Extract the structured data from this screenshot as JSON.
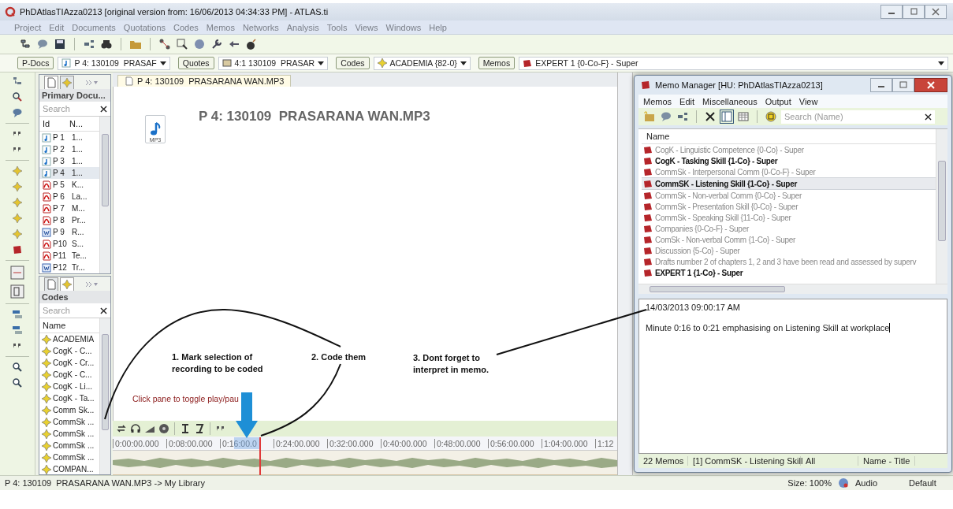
{
  "window": {
    "title": "PhDAtlasTIAzza0213 [original version from: 16/06/2013 04:34:33 PM] - ATLAS.ti"
  },
  "menu": [
    "Project",
    "Edit",
    "Documents",
    "Quotations",
    "Codes",
    "Memos",
    "Networks",
    "Analysis",
    "Tools",
    "Views",
    "Windows",
    "Help"
  ],
  "selectors": [
    {
      "button": "P-Docs",
      "value": "P 4: 130109  PRASAF",
      "kind": "audio"
    },
    {
      "button": "Quotes",
      "value": "4:1 130109  PRASAR",
      "kind": "quote"
    },
    {
      "button": "Codes",
      "value": "ACADEMIA {82-0}",
      "kind": "code"
    },
    {
      "button": "Memos",
      "value": "EXPERT 1 {0-Co-F} - Super",
      "kind": "memo"
    }
  ],
  "documents_pane": {
    "title": "Primary Docu...",
    "search": {
      "placeholder": "Search"
    },
    "columns": [
      "Id",
      "N..."
    ],
    "rows": [
      {
        "id": "P 1",
        "name": "1...",
        "kind": "audio",
        "selected": false
      },
      {
        "id": "P 2",
        "name": "1...",
        "kind": "audio",
        "selected": false
      },
      {
        "id": "P 3",
        "name": "1...",
        "kind": "audio",
        "selected": false
      },
      {
        "id": "P 4",
        "name": "1...",
        "kind": "audio",
        "selected": true
      },
      {
        "id": "P 5",
        "name": "K...",
        "kind": "pdf",
        "selected": false
      },
      {
        "id": "P 6",
        "name": "La...",
        "kind": "pdf",
        "selected": false
      },
      {
        "id": "P 7",
        "name": "M...",
        "kind": "pdf",
        "selected": false
      },
      {
        "id": "P 8",
        "name": "Pr...",
        "kind": "pdf",
        "selected": false
      },
      {
        "id": "P 9",
        "name": "R...",
        "kind": "word",
        "selected": false
      },
      {
        "id": "P10",
        "name": "S...",
        "kind": "pdf",
        "selected": false
      },
      {
        "id": "P11",
        "name": "Te...",
        "kind": "pdf",
        "selected": false
      },
      {
        "id": "P12",
        "name": "Tr...",
        "kind": "word",
        "selected": false
      }
    ]
  },
  "codes_pane": {
    "title": "Codes",
    "search": {
      "placeholder": "Search"
    },
    "columns": [
      "Name"
    ],
    "rows": [
      "ACADEMIA",
      "CogK - C...",
      "CogK - Cr...",
      "CogK - C...",
      "CogK - Li...",
      "CogK - Ta...",
      "Comm Sk...",
      "CommSk ...",
      "CommSk ...",
      "CommSk ...",
      "CommSk ...",
      "COMPAN..."
    ]
  },
  "document": {
    "tab": "P 4: 130109  PRASARANA WAN.MP3",
    "heading": "P 4: 130109  PRASARANA WAN.MP3",
    "file_badge": "MP3",
    "hint": "Click pane to toggle play/pau",
    "timeline": [
      "0:00:00.000",
      "0:08:00.000",
      "0:16:00.0",
      "0:24:00.000",
      "0:32:00.000",
      "0:40:00.000",
      "0:48:00.000",
      "0:56:00.000",
      "1:04:00.000",
      "1:12"
    ]
  },
  "annotations": [
    "1. Mark selection of\nrecording to be coded",
    "2. Code them",
    "3. Dont forget to\ninterpret in memo."
  ],
  "memo_manager": {
    "title": "Memo Manager [HU: PhDAtlasTIAzza0213]",
    "menu": [
      "Memos",
      "Edit",
      "Miscellaneous",
      "Output",
      "View"
    ],
    "search": {
      "placeholder": "Search (Name)"
    },
    "column": "Name",
    "rows": [
      {
        "name": "CogK - Linguistic Competence {0-Co} - Super",
        "bold": false,
        "selected": false
      },
      {
        "name": "CogK - Tasking Skill {1-Co} - Super",
        "bold": true,
        "selected": false
      },
      {
        "name": "CommSk - Interpersonal Comm {0-Co-F} - Super",
        "bold": false,
        "selected": false
      },
      {
        "name": "CommSK - Listening Skill {1-Co} - Super",
        "bold": true,
        "selected": true
      },
      {
        "name": "CommSk - Non-verbal Comm {0-Co} - Super",
        "bold": false,
        "selected": false
      },
      {
        "name": "CommSk - Presentation Skill {0-Co} - Super",
        "bold": false,
        "selected": false
      },
      {
        "name": "CommSk - Speaking Skill {11-Co} - Super",
        "bold": false,
        "selected": false
      },
      {
        "name": "Companies {0-Co-F} - Super",
        "bold": false,
        "selected": false
      },
      {
        "name": "ComSk - Non-verbal Comm {1-Co} - Super",
        "bold": false,
        "selected": false
      },
      {
        "name": "Discussion {5-Co} - Super",
        "bold": false,
        "selected": false
      },
      {
        "name": "Drafts number 2 of chapters 1, 2 and 3 have been read and assessed by superv",
        "bold": false,
        "selected": false
      },
      {
        "name": "EXPERT 1 {1-Co} - Super",
        "bold": true,
        "selected": false
      }
    ],
    "date": "14/03/2013 09:00:17 AM",
    "text": "Minute 0:16 to 0:21 emphasising on Listening Skill at workplace",
    "status": [
      "22 Memos",
      "[1] CommSK - Listening Skill",
      "All",
      "Name - Title"
    ]
  },
  "status_bar": {
    "path": "P 4: 130109  PRASARANA WAN.MP3 -> My Library",
    "size": "Size: 100%",
    "mode": "Audio",
    "layout": "Default"
  }
}
